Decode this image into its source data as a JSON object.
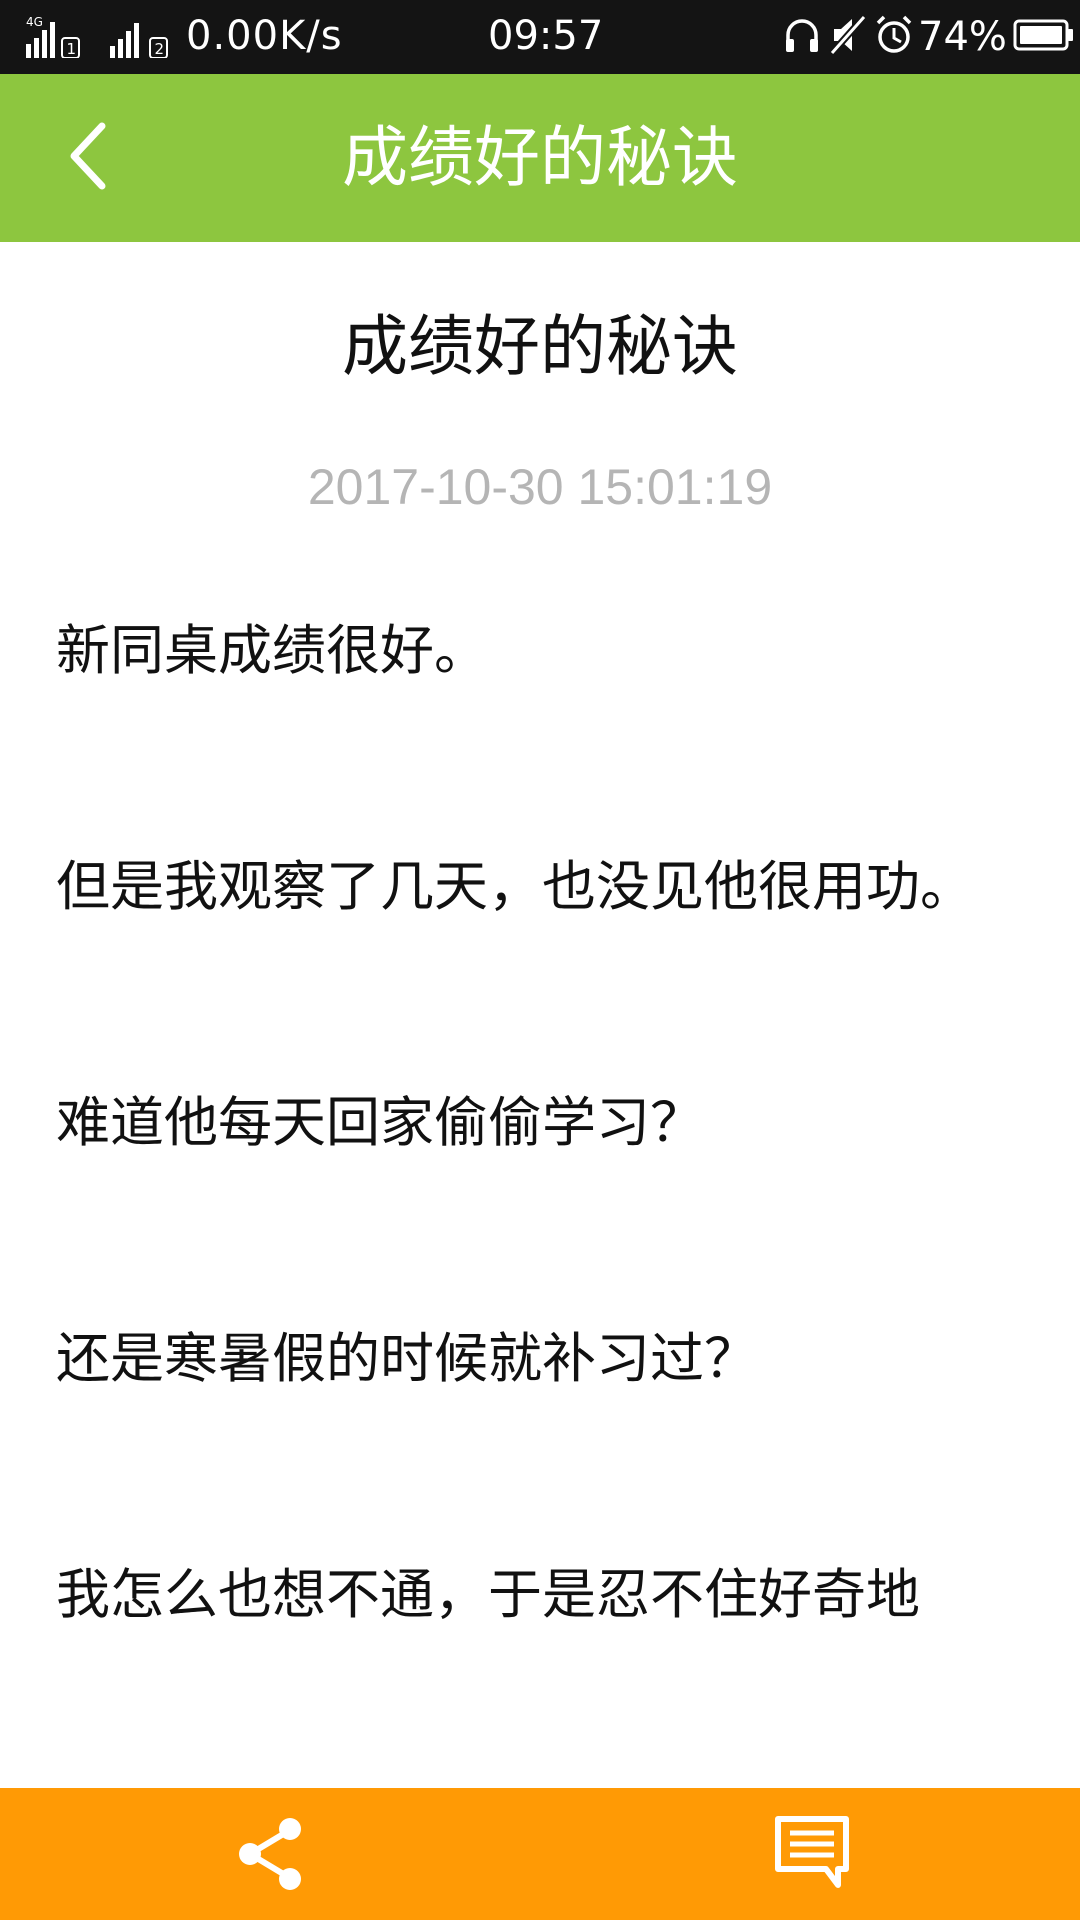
{
  "status_bar": {
    "network_type": "4G",
    "sim1_label": "1",
    "sim2_label": "2",
    "net_speed": "0.00K/s",
    "time": "09:57",
    "battery_percent": "74%",
    "icons": [
      "signal-icon",
      "headphone-icon",
      "mute-icon",
      "alarm-icon",
      "battery-icon"
    ]
  },
  "app_bar": {
    "back_icon": "chevron-left-icon",
    "title": "成绩好的秘诀",
    "background_color": "#8dc63f"
  },
  "article": {
    "title": "成绩好的秘诀",
    "date": "2017-10-30 15:01:19",
    "paragraphs": [
      "新同桌成绩很好。",
      "但是我观察了几天，也没见他很用功。",
      "难道他每天回家偷偷学习？",
      "还是寒暑假的时候就补习过？",
      "我怎么也想不通，于是忍不住好奇地"
    ]
  },
  "bottom_bar": {
    "background_color": "#ff9a05",
    "share_icon": "share-icon",
    "comment_icon": "comment-icon"
  }
}
